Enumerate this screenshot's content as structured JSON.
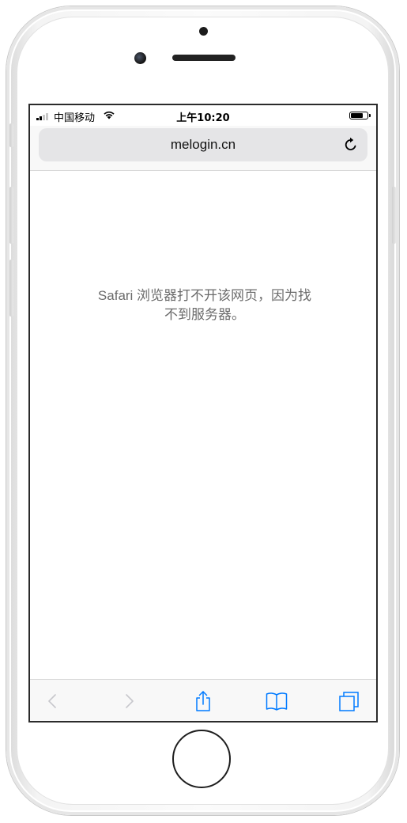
{
  "status_bar": {
    "carrier": "中国移动",
    "time": "上午10:20",
    "signal_bars": 4,
    "signal_active": 2,
    "battery_level": 0.85
  },
  "address_bar": {
    "url": "melogin.cn",
    "reload_icon": "reload-icon"
  },
  "page": {
    "error_line1": "Safari 浏览器打不开该网页，因为找",
    "error_line2": "不到服务器。"
  },
  "toolbar": {
    "items": [
      "back-icon",
      "forward-icon",
      "share-icon",
      "bookmarks-icon",
      "tabs-icon"
    ]
  },
  "colors": {
    "accent": "#007aff",
    "disabled": "#c7c7cc",
    "message_text": "#6b6b6b"
  }
}
